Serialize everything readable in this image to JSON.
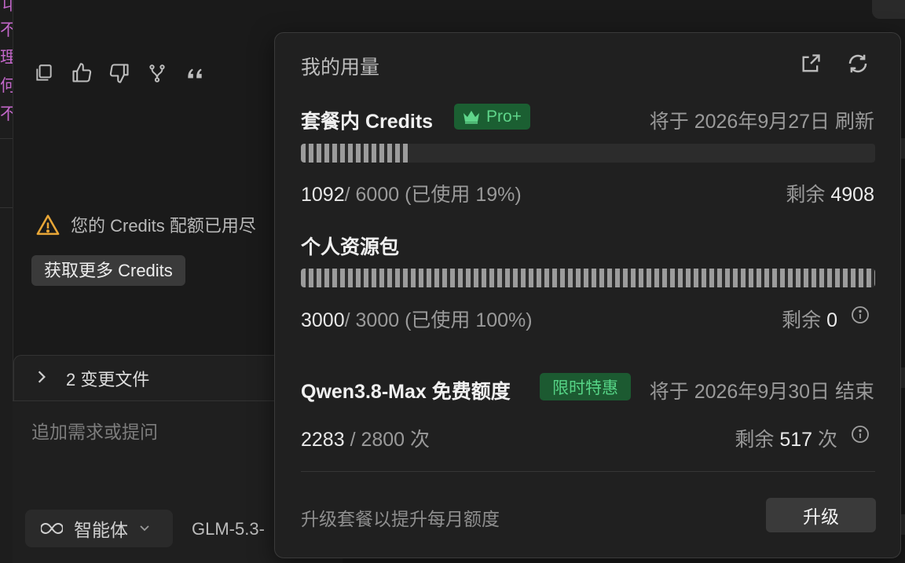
{
  "left_strip": {
    "glyphs": [
      "丩",
      "不i",
      "理",
      "何",
      "不"
    ]
  },
  "message_actions": [
    "copy",
    "thumbs-up",
    "thumbs-down",
    "branch",
    "quote"
  ],
  "warning": {
    "text": "您的 Credits 配额已用尽"
  },
  "get_more_button": {
    "label": "获取更多 Credits"
  },
  "changes": {
    "label": "2 变更文件"
  },
  "composer": {
    "placeholder": "追加需求或提问",
    "agent_label": "智能体",
    "model_label": "GLM-5.3-"
  },
  "usage_popup": {
    "title": "我的用量",
    "plan": {
      "title": "套餐内 Credits",
      "badge": "Pro+",
      "refresh_text": "将于 2026年9月27日 刷新",
      "used": "1092",
      "total": "/ 6000 (已使用 19%)",
      "used_fraction": 0.19,
      "remain_label": "剩余",
      "remain_value": "4908"
    },
    "personal": {
      "title": "个人资源包",
      "used": "3000",
      "total": "/ 3000 (已使用 100%)",
      "used_fraction": 1.0,
      "remain_label": "剩余",
      "remain_value": "0"
    },
    "qwen": {
      "title": "Qwen3.8-Max 免费额度",
      "badge": "限时特惠",
      "end_text": "将于 2026年9月30日 结束",
      "used": "2283",
      "total": "/ 2800 次",
      "remain_label": "剩余",
      "remain_value": "517",
      "remain_unit": "次"
    },
    "footer_text": "升级套餐以提升每月额度",
    "upgrade_button": "升级"
  },
  "colors": {
    "background": "#1a1a1a",
    "popup_bg": "#202020",
    "badge_green": "#5fd58a",
    "badge_green_bg": "#1b5f32",
    "bar_fill": "#9c9c9c"
  }
}
